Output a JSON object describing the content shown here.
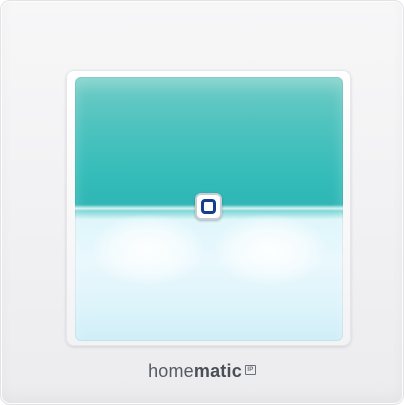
{
  "brand": {
    "prefix": "home",
    "suffix": "matic",
    "badge": "IP"
  },
  "colors": {
    "panel_top": "#33bcb9",
    "panel_bottom": "#e9f8fd",
    "led_border": "#163d8f"
  }
}
